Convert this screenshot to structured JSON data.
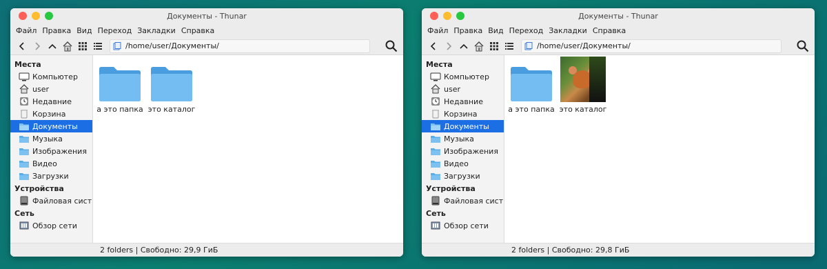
{
  "windows": [
    {
      "title": "Документы - Thunar",
      "menu": [
        "Файл",
        "Правка",
        "Вид",
        "Переход",
        "Закладки",
        "Справка"
      ],
      "path": "/home/user/Документы/",
      "sidebar": {
        "places_header": "Места",
        "places": [
          "Компьютер",
          "user",
          "Недавние",
          "Корзина",
          "Документы",
          "Музыка",
          "Изображения",
          "Видео",
          "Загрузки"
        ],
        "devices_header": "Устройства",
        "devices": [
          "Файловая сист…"
        ],
        "network_header": "Сеть",
        "network": [
          "Обзор сети"
        ]
      },
      "files": [
        {
          "name": "а это папка",
          "icon": "folder-icon"
        },
        {
          "name": "это каталог",
          "icon": "folder-icon"
        }
      ],
      "status": "2 folders | Свободно: 29,9 ГиБ"
    },
    {
      "title": "Документы - Thunar",
      "menu": [
        "Файл",
        "Правка",
        "Вид",
        "Переход",
        "Закладки",
        "Справка"
      ],
      "path": "/home/user/Документы/",
      "sidebar": {
        "places_header": "Места",
        "places": [
          "Компьютер",
          "user",
          "Недавние",
          "Корзина",
          "Документы",
          "Музыка",
          "Изображения",
          "Видео",
          "Загрузки"
        ],
        "devices_header": "Устройства",
        "devices": [
          "Файловая сист…"
        ],
        "network_header": "Сеть",
        "network": [
          "Обзор сети"
        ]
      },
      "files": [
        {
          "name": "а это папка",
          "icon": "folder-icon"
        },
        {
          "name": "это каталог",
          "icon": "image-thumbnail-icon"
        }
      ],
      "status": "2 folders | Свободно: 29,8 ГиБ"
    }
  ],
  "colors": {
    "selection": "#1b6ee3",
    "folder": "#5aaee8",
    "desktop": "#0b7d6f"
  }
}
